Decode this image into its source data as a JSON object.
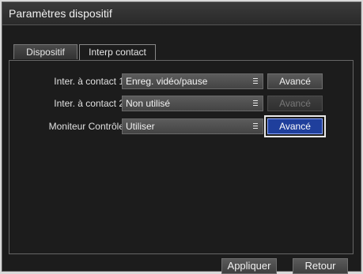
{
  "window": {
    "title": "Paramètres dispositif"
  },
  "tabs": [
    {
      "label": "Dispositif",
      "active": false
    },
    {
      "label": "Interp contact",
      "active": true
    }
  ],
  "rows": [
    {
      "label": "Inter. à contact 1",
      "value": "Enreg. vidéo/pause",
      "button": "Avancé",
      "button_state": "enabled"
    },
    {
      "label": "Inter. à contact 2",
      "value": "Non utilisé",
      "button": "Avancé",
      "button_state": "disabled"
    },
    {
      "label": "Moniteur Contrôle",
      "value": "Utiliser",
      "button": "Avancé",
      "button_state": "focused"
    }
  ],
  "footer": {
    "apply_label": "Appliquer",
    "back_label": "Retour"
  },
  "colors": {
    "focus_blue": "#1f3f9c",
    "background": "#1c1c1c"
  },
  "icons": {
    "select": "list-icon"
  }
}
